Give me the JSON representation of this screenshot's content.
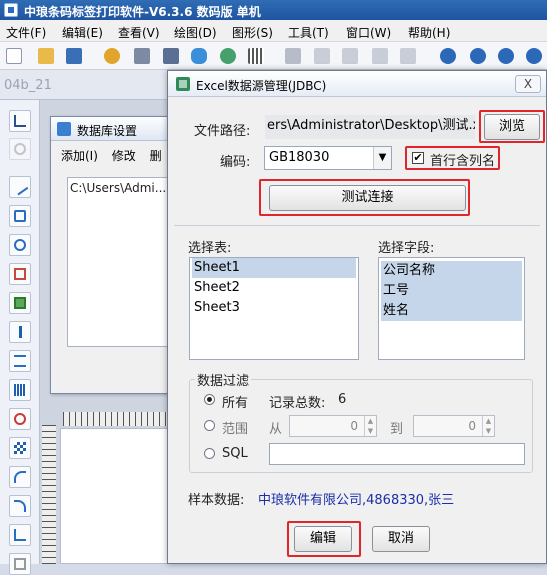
{
  "app": {
    "title": "中琅条码标签打印软件-V6.3.6 数码版 单机"
  },
  "menu": [
    "文件(F)",
    "编辑(E)",
    "查看(V)",
    "绘图(D)",
    "图形(S)",
    "工具(T)",
    "窗口(W)",
    "帮助(H)"
  ],
  "tab": {
    "label": "04b_21"
  },
  "db_window": {
    "title": "数据库设置",
    "menu_add": "添加(I)",
    "menu_edit": "修改",
    "menu_more": "删",
    "list_item": "C:\\Users\\Admi..."
  },
  "dialog": {
    "title": "Excel数据源管理(JDBC)",
    "close": "X",
    "path_label": "文件路径:",
    "path_value": "ers\\Administrator\\Desktop\\测试.xls",
    "browse": "浏览",
    "encoding_label": "编码:",
    "encoding_value": "GB18030",
    "header_row_label": "首行含列名",
    "header_row_checked": true,
    "test_button": "测试连接",
    "tables_label": "选择表:",
    "tables": [
      "Sheet1",
      "Sheet2",
      "Sheet3"
    ],
    "fields_label": "选择字段:",
    "fields": [
      "公司名称",
      "工号",
      "姓名"
    ],
    "filter_label": "数据过滤",
    "opt_all": "所有",
    "total_label": "记录总数:",
    "total_value": "6",
    "opt_range": "范围",
    "from_label": "从",
    "from_value": "0",
    "to_label": "到",
    "to_value": "0",
    "opt_sql": "SQL",
    "sample_label": "样本数据:",
    "sample_value": "中琅软件有限公司,4868330,张三",
    "edit_button": "编辑",
    "cancel_button": "取消"
  },
  "colors": {
    "highlight": "#e0262b",
    "selection": "#c5d5ea",
    "sample_text": "#1a2fa8"
  }
}
